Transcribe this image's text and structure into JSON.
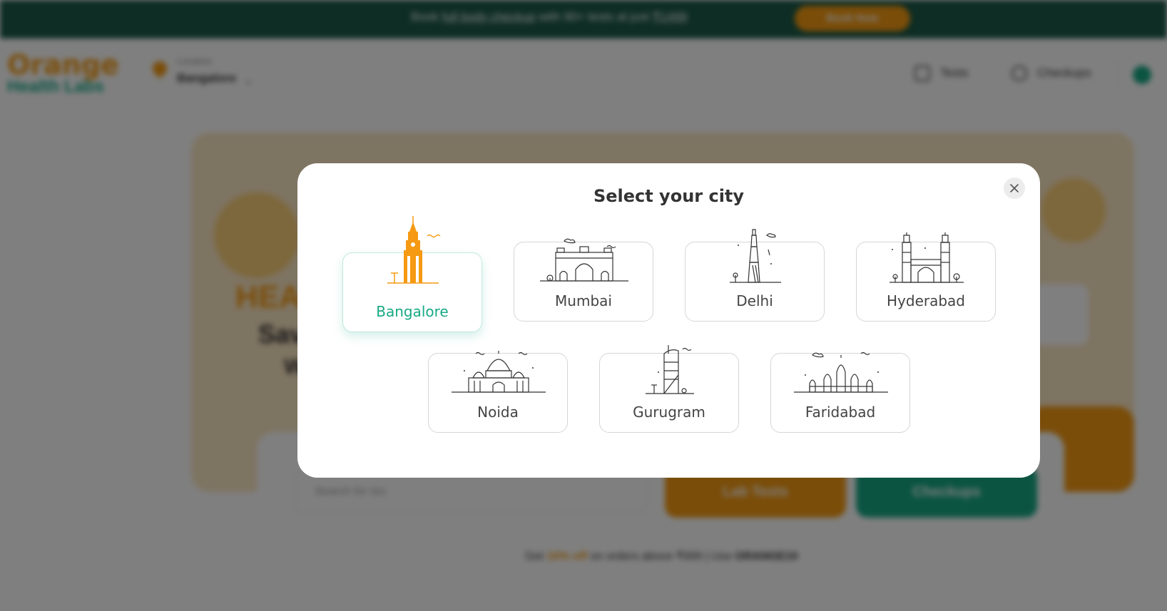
{
  "promo": {
    "text_prefix": "Book",
    "text_link": "full body checkup",
    "text_mid": "with 90+ tests at just",
    "text_price": "₹1499",
    "button": "Book Now"
  },
  "header": {
    "logo_line1": "Orange",
    "logo_line2": "Health Labs",
    "location_label": "Location",
    "location_city": "Bangalore",
    "nav": [
      "Tests",
      "Checkups"
    ]
  },
  "hero": {
    "line1": "HEA",
    "line2": "Sav",
    "line3": "W",
    "search_placeholder": "Search for tes",
    "btn_orange": "Lab Tests",
    "btn_green": "Checkups",
    "note_prefix": "Get",
    "note_highlight": "10% off",
    "note_mid": "on orders above ₹999 | Use",
    "note_code": "ORANGE10"
  },
  "modal": {
    "title": "Select your city",
    "close_icon": "close-icon",
    "selected_city": "Bangalore",
    "cities": [
      "Bangalore",
      "Mumbai",
      "Delhi",
      "Hyderabad",
      "Noida",
      "Gurugram",
      "Faridabad"
    ]
  },
  "colors": {
    "brand_orange": "#f59a12",
    "brand_green": "#17a985",
    "promo_bg": "#1c5a48"
  }
}
